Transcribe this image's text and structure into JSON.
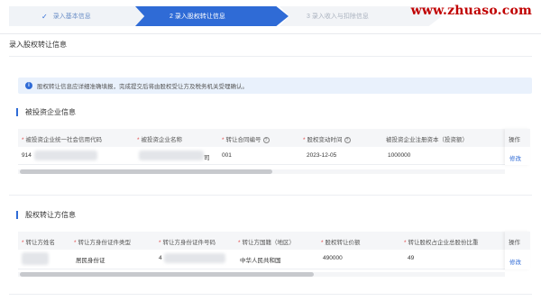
{
  "steps": {
    "step1": {
      "label": "录入基本信息",
      "status": "done"
    },
    "step2": {
      "label": "2  录入股权转让信息",
      "status": "active"
    },
    "step3": {
      "label": "3  录入收入与扣除信息",
      "status": "pending"
    }
  },
  "watermark": "www.zhuaso.com",
  "page_title": "录入股权转让信息",
  "notice": "股权转让信息应详细准确填报，完成提交后将由股权受让方及税务机关受理确认。",
  "invested": {
    "title": "被投资企业信息",
    "headers": {
      "credit_code": "被投资企业统一社会信用代码",
      "company_name": "被投资企业名称",
      "contract_no": "转让合同编号",
      "change_date": "股权变动时间",
      "reg_capital": "被投资企业注册资本（投资额）",
      "op": "操作"
    },
    "row": {
      "credit_code": "914",
      "company_name_tail": "司",
      "contract_no": "001",
      "change_date": "2023-12-05",
      "reg_capital": "1000000",
      "op": "修改"
    }
  },
  "transferor": {
    "title": "股权转让方信息",
    "headers": {
      "name": "转让方姓名",
      "id_type": "转让方身份证件类型",
      "id_no": "转让方身份证件号码",
      "nationality": "转让方国籍（地区）",
      "price": "股权转让价额",
      "ratio": "转让股权占企业总股份比重",
      "op": "操作"
    },
    "row": {
      "id_type": "居民身份证",
      "id_no": "4",
      "nationality": "中华人民共和国",
      "price": "490000",
      "ratio": "49",
      "op": "修改"
    }
  },
  "colors": {
    "accent": "#2f6bd6",
    "required": "#e04c4c",
    "watermark": "#c00000"
  }
}
